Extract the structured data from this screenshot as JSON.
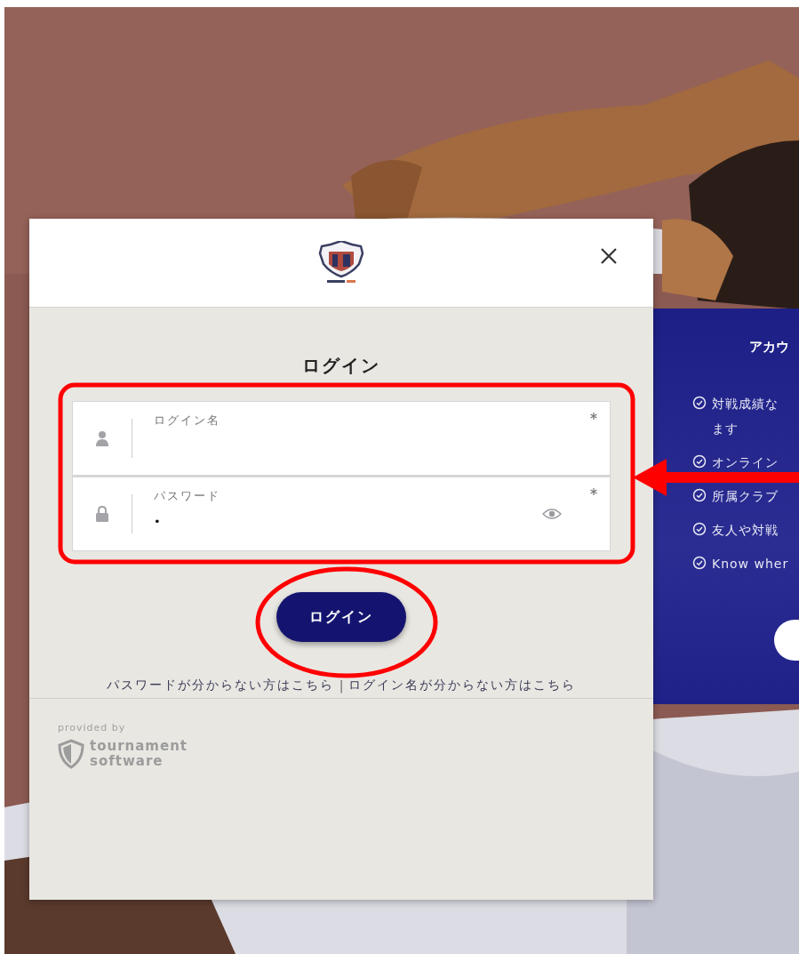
{
  "side_panel": {
    "title": "アカウ",
    "features": [
      {
        "lines": [
          "対戦成績な",
          "ます"
        ]
      },
      {
        "lines": [
          "オンライン"
        ]
      },
      {
        "lines": [
          "所属クラブ"
        ]
      },
      {
        "lines": [
          "友人や対戦"
        ]
      },
      {
        "lines": [
          "Know wher"
        ]
      }
    ]
  },
  "modal": {
    "title": "ログイン",
    "fields": [
      {
        "kind": "text",
        "label": "ログイン名",
        "required": true
      },
      {
        "kind": "password",
        "label": "パスワード",
        "value": "•",
        "required": true
      }
    ],
    "submit": "ログイン",
    "links": [
      "パスワードが分からない方はこちら",
      "|",
      "ログイン名が分からない方はこちら"
    ],
    "footer": {
      "caption": "provided by",
      "brand": "tournament software"
    }
  }
}
